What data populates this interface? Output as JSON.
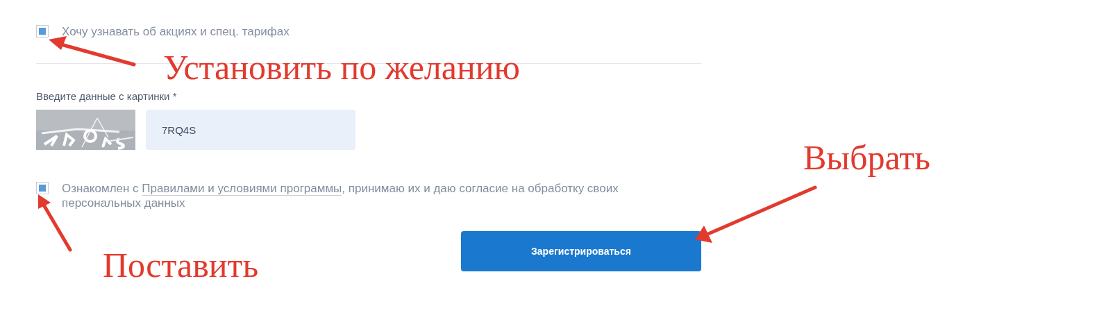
{
  "promo": {
    "checked": true,
    "label": "Хочу узнавать об акциях и спец. тарифах"
  },
  "captcha": {
    "label": "Введите данные с картинки *",
    "value": "7RQ4S"
  },
  "consent": {
    "checked": true,
    "before": "Ознакомлен с ",
    "link": "Правилами и условиями программы",
    "after": ", принимаю их и даю согласие на обработку своих персональных данных"
  },
  "submit": "Зарегистрироваться",
  "annotations": [
    {
      "text": "Установить по желанию"
    },
    {
      "text": "Выбрать"
    },
    {
      "text": "Поставить"
    }
  ]
}
